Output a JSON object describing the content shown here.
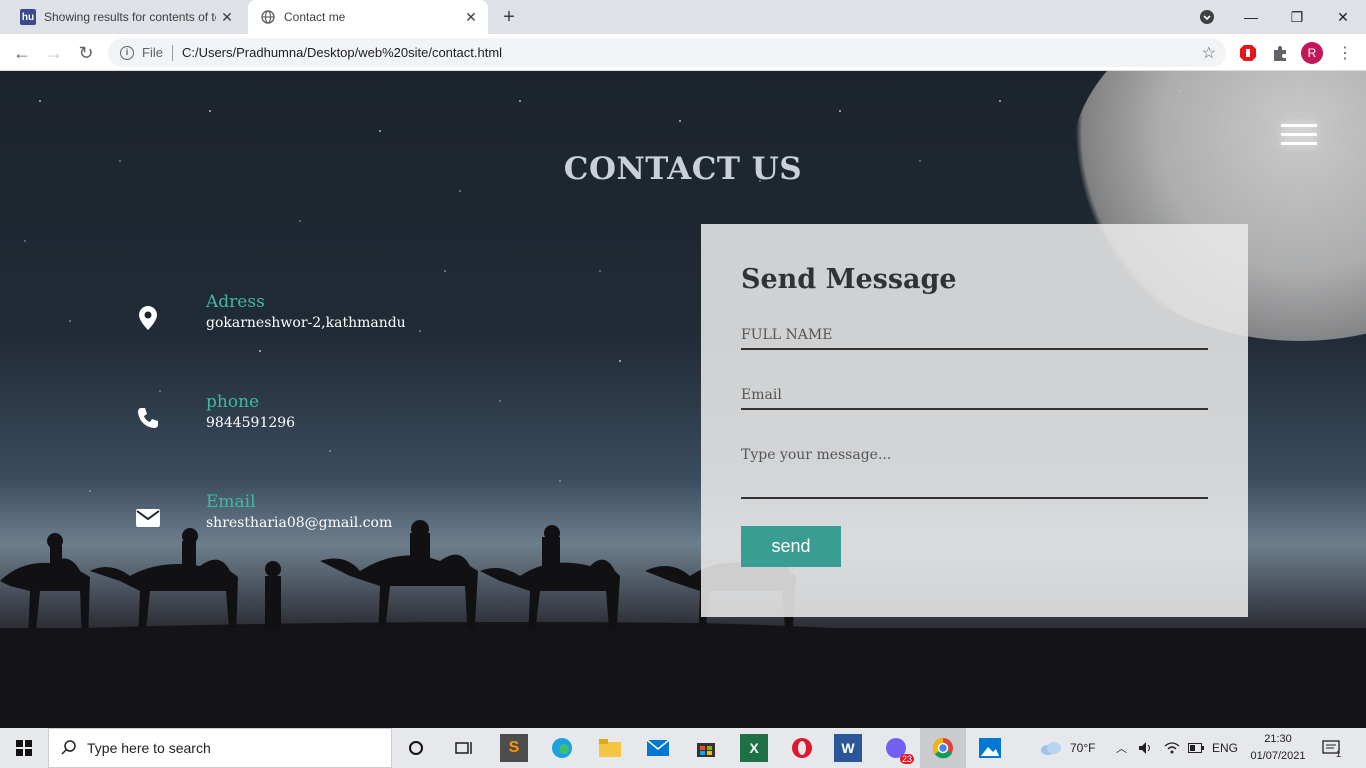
{
  "browser": {
    "tabs": [
      {
        "title": "Showing results for contents of te",
        "favicon": "hu"
      },
      {
        "title": "Contact me",
        "favicon": "globe-icon"
      }
    ],
    "address": {
      "scheme_label": "File",
      "url": "C:/Users/Pradhumna/Desktop/web%20site/contact.html"
    },
    "profile_initial": "R"
  },
  "page": {
    "title": "CONTACT US",
    "contact_items": [
      {
        "label": "Adress",
        "value": "gokarneshwor-2,kathmandu",
        "icon": "map-marker-icon"
      },
      {
        "label": "phone",
        "value": "9844591296",
        "icon": "phone-icon"
      },
      {
        "label": "Email",
        "value": "shrestharia08@gmail.com",
        "icon": "envelope-icon"
      }
    ],
    "form": {
      "heading": "Send Message",
      "fullname_placeholder": "FULL NAME",
      "email_placeholder": "Email",
      "message_placeholder": "Type your message...",
      "send_label": "send"
    },
    "accent_color": "#3fb8a7",
    "button_color": "#3a9d94"
  },
  "taskbar": {
    "search_placeholder": "Type here to search",
    "weather": "70°F",
    "language": "ENG",
    "time": "21:30",
    "date": "01/07/2021",
    "viber_badge": "23",
    "notification_count": "1"
  }
}
